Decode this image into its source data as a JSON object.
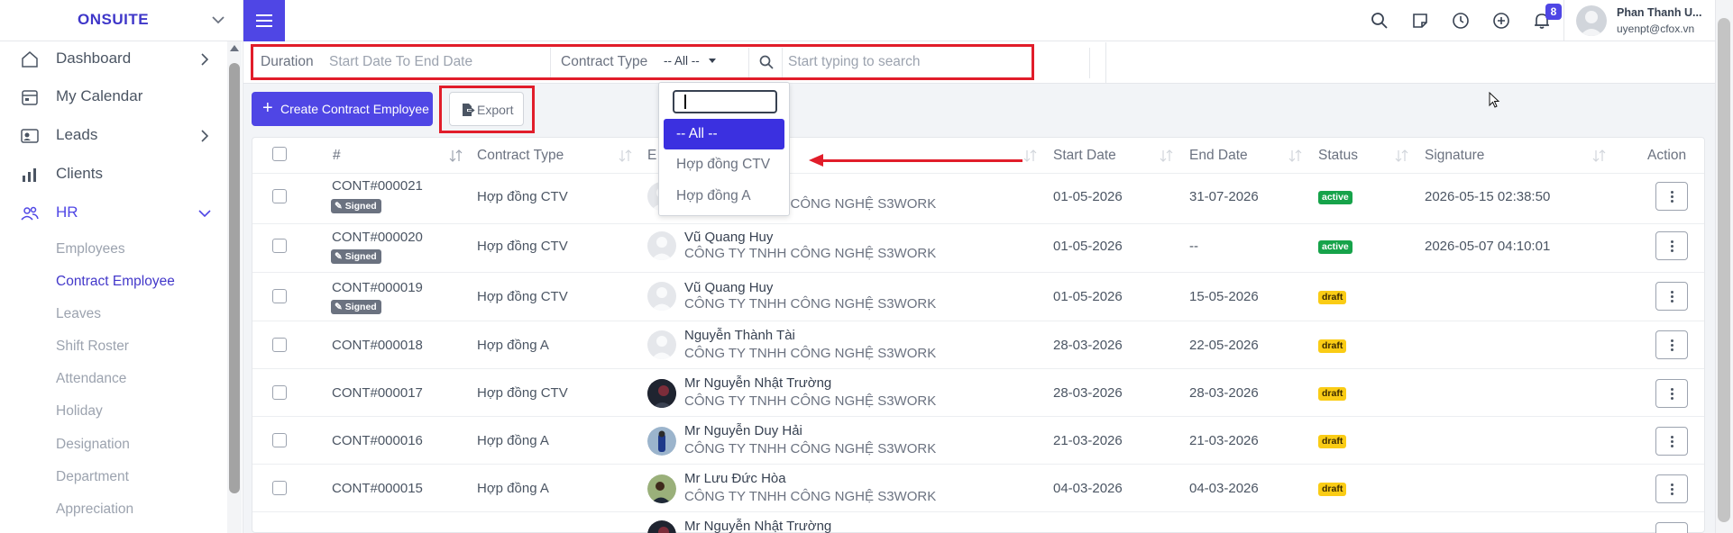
{
  "app": {
    "brand": "ONSUITE"
  },
  "sidebar": {
    "items": [
      {
        "label": "Dashboard"
      },
      {
        "label": "My Calendar"
      },
      {
        "label": "Leads"
      },
      {
        "label": "Clients"
      },
      {
        "label": "HR"
      }
    ],
    "hr_children": [
      "Employees",
      "Contract Employee",
      "Leaves",
      "Shift Roster",
      "Attendance",
      "Holiday",
      "Designation",
      "Department",
      "Appreciation"
    ]
  },
  "topbar": {
    "notification_count": "8",
    "user_name": "Phan Thanh U...",
    "user_email": "uyenpt@cfox.vn"
  },
  "filters": {
    "duration_label": "Duration",
    "duration_placeholder": "Start Date To End Date",
    "contract_type_label": "Contract Type",
    "contract_type_value": "-- All --",
    "search_placeholder": "Start typing to search"
  },
  "actions": {
    "create_label": "Create Contract Employee",
    "export_label": "Export"
  },
  "dropdown": {
    "options": [
      "-- All --",
      "Hợp đồng CTV",
      "Hợp đồng A"
    ],
    "selected": "-- All --"
  },
  "table": {
    "headers": [
      "#",
      "Contract Type",
      "E",
      "Start Date",
      "End Date",
      "Status",
      "Signature",
      "Action"
    ],
    "rows": [
      {
        "id": "CONT#000021",
        "signed": "Signed",
        "type": "Hợp đồng CTV",
        "name": "",
        "company": "CÔNG TY TNHH CÔNG NGHỆ S3WORK",
        "start": "01-05-2026",
        "end": "31-07-2026",
        "status": "active",
        "signature": "2026-05-15 02:38:50"
      },
      {
        "id": "CONT#000020",
        "signed": "Signed",
        "type": "Hợp đồng CTV",
        "name": "Vũ Quang Huy",
        "company": "CÔNG TY TNHH CÔNG NGHỆ S3WORK",
        "start": "01-05-2026",
        "end": "--",
        "status": "active",
        "signature": "2026-05-07 04:10:01"
      },
      {
        "id": "CONT#000019",
        "signed": "Signed",
        "type": "Hợp đồng CTV",
        "name": "Vũ Quang Huy",
        "company": "CÔNG TY TNHH CÔNG NGHỆ S3WORK",
        "start": "01-05-2026",
        "end": "15-05-2026",
        "status": "draft",
        "signature": ""
      },
      {
        "id": "CONT#000018",
        "signed": "",
        "type": "Hợp đồng A",
        "name": "Nguyễn Thành Tài",
        "company": "CÔNG TY TNHH CÔNG NGHỆ S3WORK",
        "start": "28-03-2026",
        "end": "22-05-2026",
        "status": "draft",
        "signature": ""
      },
      {
        "id": "CONT#000017",
        "signed": "",
        "type": "Hợp đồng CTV",
        "name": "Mr Nguyễn Nhật Trường",
        "company": "CÔNG TY TNHH CÔNG NGHỆ S3WORK",
        "start": "28-03-2026",
        "end": "28-03-2026",
        "status": "draft",
        "signature": ""
      },
      {
        "id": "CONT#000016",
        "signed": "",
        "type": "Hợp đồng A",
        "name": "Mr Nguyễn Duy Hải",
        "company": "CÔNG TY TNHH CÔNG NGHỆ S3WORK",
        "start": "21-03-2026",
        "end": "21-03-2026",
        "status": "draft",
        "signature": ""
      },
      {
        "id": "CONT#000015",
        "signed": "",
        "type": "Hợp đồng A",
        "name": "Mr Lưu Đức Hòa",
        "company": "CÔNG TY TNHH CÔNG NGHỆ S3WORK",
        "start": "04-03-2026",
        "end": "04-03-2026",
        "status": "draft",
        "signature": ""
      },
      {
        "id": "",
        "signed": "",
        "type": "",
        "name": "Mr Nguyễn Nhật Trường",
        "company": "",
        "start": "",
        "end": "",
        "status": "",
        "signature": ""
      }
    ]
  },
  "colors": {
    "accent": "#4f46e5",
    "annotation": "#e11d2a",
    "active": "#16a34a",
    "draft": "#facc15"
  }
}
